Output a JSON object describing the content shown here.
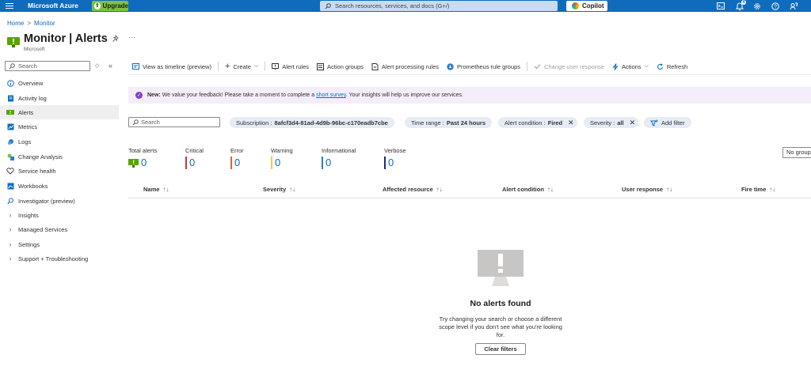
{
  "topbar": {
    "brand": "Microsoft Azure",
    "upgrade": "Upgrade",
    "search_placeholder": "Search resources, services, and docs (G+/)",
    "copilot": "Copilot",
    "notification_count": "4"
  },
  "breadcrumb": {
    "home": "Home",
    "sep": ">",
    "current": "Monitor"
  },
  "header": {
    "title": "Monitor | Alerts",
    "subtitle": "Microsoft",
    "more": "···"
  },
  "sidebar": {
    "search_placeholder": "Search",
    "sort": "◇",
    "collapse": "«",
    "items": [
      {
        "label": "Overview"
      },
      {
        "label": "Activity log"
      },
      {
        "label": "Alerts",
        "active": true
      },
      {
        "label": "Metrics"
      },
      {
        "label": "Logs"
      },
      {
        "label": "Change Analysis"
      },
      {
        "label": "Service health"
      },
      {
        "label": "Workbooks"
      },
      {
        "label": "Investigator (preview)"
      },
      {
        "label": "Insights"
      },
      {
        "label": "Managed Services"
      },
      {
        "label": "Settings"
      },
      {
        "label": "Support + Troubleshooting"
      }
    ]
  },
  "toolbar": {
    "timeline": "View as timeline (preview)",
    "create": "Create",
    "alert_rules": "Alert rules",
    "action_groups": "Action groups",
    "processing_rules": "Alert processing rules",
    "prometheus": "Prometheus rule groups",
    "change_response": "Change user response",
    "actions": "Actions",
    "refresh": "Refresh"
  },
  "banner": {
    "new": "New:",
    "text_before": "We value your feedback! Please take a moment to complete a",
    "link": "short survey",
    "text_after": ". Your insights will help us improve our services."
  },
  "filters": {
    "search_placeholder": "Search",
    "subscription_label": "Subscription :",
    "subscription_value": "8afcf3d4-81ad-4d9b-96bc-c170eadb7cbe",
    "time_label": "Time range :",
    "time_value": "Past 24 hours",
    "condition_label": "Alert condition :",
    "condition_value": "Fired",
    "severity_label": "Severity :",
    "severity_value": "all",
    "add_filter": "Add filter"
  },
  "counts": {
    "total": {
      "label": "Total alerts",
      "value": "0"
    },
    "critical": {
      "label": "Critical",
      "value": "0",
      "color": "#d13438"
    },
    "error": {
      "label": "Error",
      "value": "0",
      "color": "#e0652f"
    },
    "warning": {
      "label": "Warning",
      "value": "0",
      "color": "#f2c94c"
    },
    "informational": {
      "label": "Informational",
      "value": "0",
      "color": "#2b7fd3"
    },
    "verbose": {
      "label": "Verbose",
      "value": "0",
      "color": "#1b2a8a"
    }
  },
  "grouping": "No grouping",
  "table": {
    "columns": [
      "Name",
      "Severity",
      "Affected resource",
      "Alert condition",
      "User response",
      "Fire time"
    ],
    "sort_glyph": "↑↓"
  },
  "empty": {
    "title": "No alerts found",
    "text": "Try changing your search or choose a different scope level if you don't see what you're looking for.",
    "button": "Clear filters"
  },
  "colors": {
    "accent": "#0f6cbd",
    "monitor_green": "#57a300"
  }
}
